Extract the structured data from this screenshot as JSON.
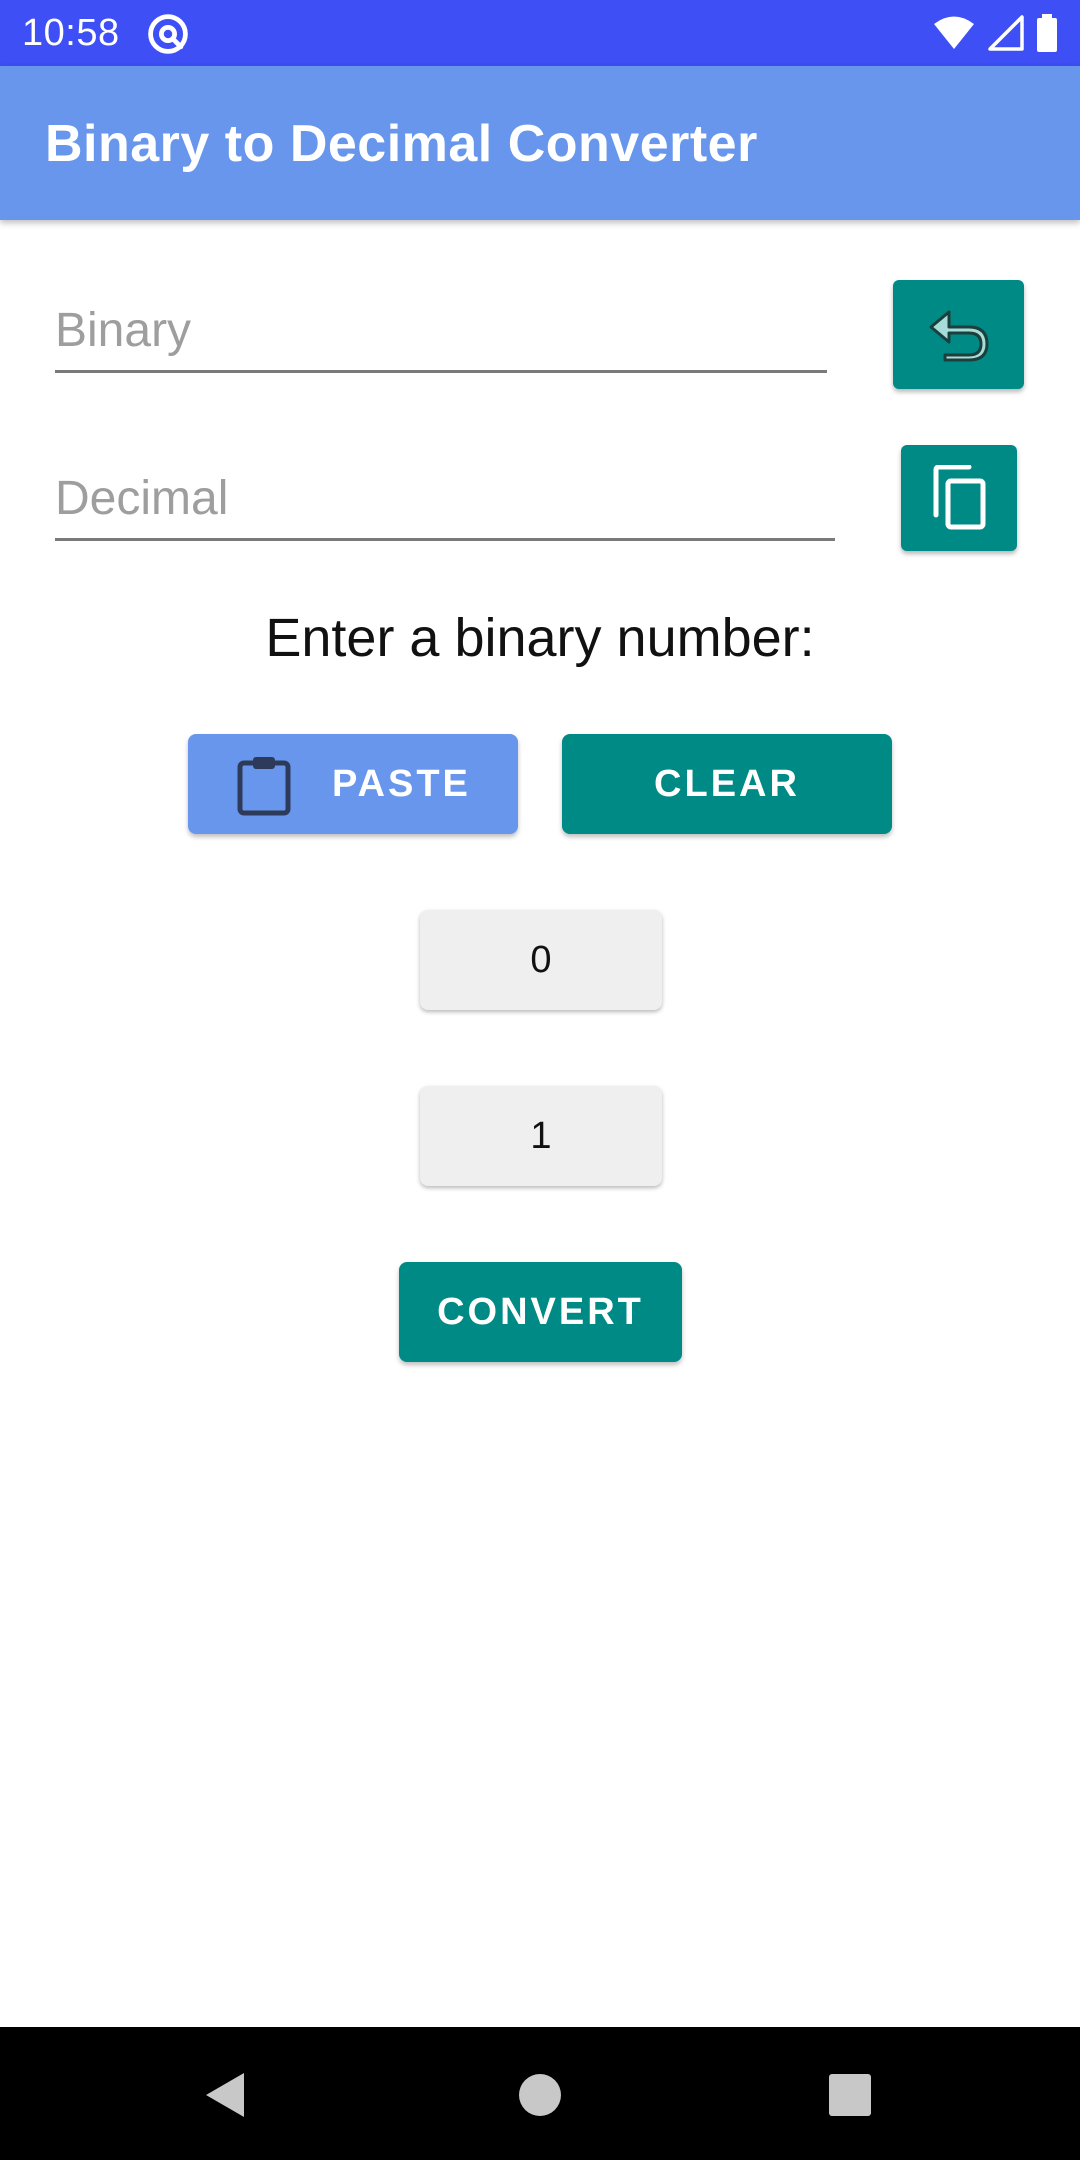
{
  "status_bar": {
    "time": "10:58",
    "app_icon": "at-sign-icon",
    "icons": [
      "wifi-icon",
      "signal-icon",
      "battery-icon"
    ]
  },
  "app_bar": {
    "title": "Binary to Decimal Converter"
  },
  "inputs": {
    "binary": {
      "value": "",
      "placeholder": "Binary"
    },
    "decimal": {
      "value": "",
      "placeholder": "Decimal"
    }
  },
  "side_buttons": {
    "undo_icon": "undo-icon",
    "copy_icon": "copy-icon"
  },
  "prompt": "Enter a binary number:",
  "actions": {
    "paste_label": "PASTE",
    "paste_icon": "clipboard-icon",
    "clear_label": "CLEAR"
  },
  "digits": {
    "zero": "0",
    "one": "1"
  },
  "convert_label": "CONVERT",
  "nav_bar": {
    "icons": [
      "back-icon",
      "home-icon",
      "recents-icon"
    ]
  },
  "colors": {
    "status_bar": "#3d4ff5",
    "app_bar": "#6796ec",
    "teal": "#008a85",
    "paste_button": "#6796ec",
    "digit_button": "#efefef"
  }
}
